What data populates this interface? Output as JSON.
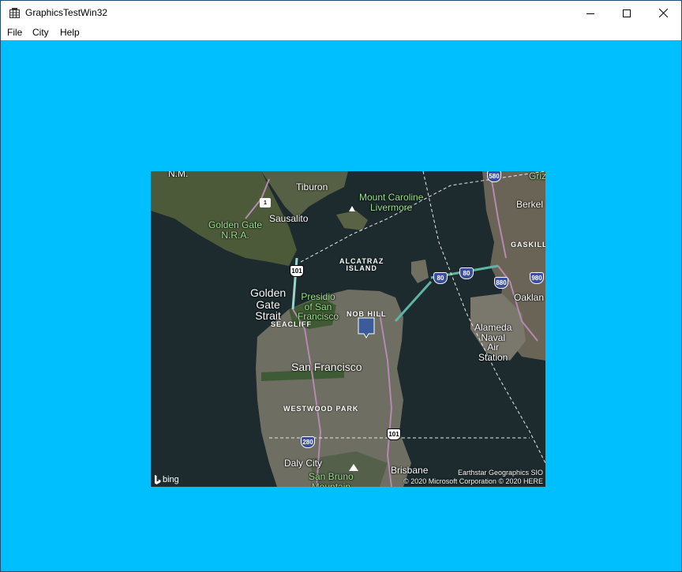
{
  "window": {
    "title": "GraphicsTestWin32",
    "app_icon": "app-grid-icon",
    "controls": {
      "minimize": "minimize-icon",
      "maximize": "maximize-icon",
      "close": "close-icon"
    }
  },
  "menu": {
    "items": [
      {
        "label": "File"
      },
      {
        "label": "City"
      },
      {
        "label": "Help"
      }
    ]
  },
  "colors": {
    "client_background": "#00bfff",
    "pin_fill": "#3b5b9a",
    "water": "#1d2b2e",
    "interstate_shield": "#3b4f9e"
  },
  "map": {
    "labels": {
      "nm": "N.M.",
      "tiburon": "Tiburon",
      "mount_caroline": "Mount Caroline\nLivermore",
      "sausalito": "Sausalito",
      "golden_gate_nra": "Golden Gate\nN.R.A.",
      "alcatraz": "ALCATRAZ\nISLAND",
      "golden_gate_strait": "Golden\nGate\nStrait",
      "presidio": "Presidio\nof San\nFrancisco",
      "seacliff": "SEACLIFF",
      "nob_hill": "NOB HILL",
      "san_francisco": "San Francisco",
      "westwood_park": "WESTWOOD PARK",
      "daly_city": "Daly City",
      "brisbane": "Brisbane",
      "san_bruno": "San Bruno\nMountain",
      "berkeley": "Berkel",
      "gaskill": "GASKILL",
      "oakland": "Oaklan",
      "alameda": "Alameda\nNaval\nAir\nStation",
      "griz": "Griz"
    },
    "shields": {
      "ca1": "1",
      "us101_north": "101",
      "i80_a": "80",
      "i80_b": "80",
      "i880": "880",
      "i980": "980",
      "i580": "580",
      "i280": "280",
      "us101_south": "101"
    },
    "attribution": {
      "line1": "Earthstar Geographics  SIO",
      "line2": "© 2020 Microsoft Corporation © 2020 HERE"
    },
    "logo_text": "bing"
  }
}
